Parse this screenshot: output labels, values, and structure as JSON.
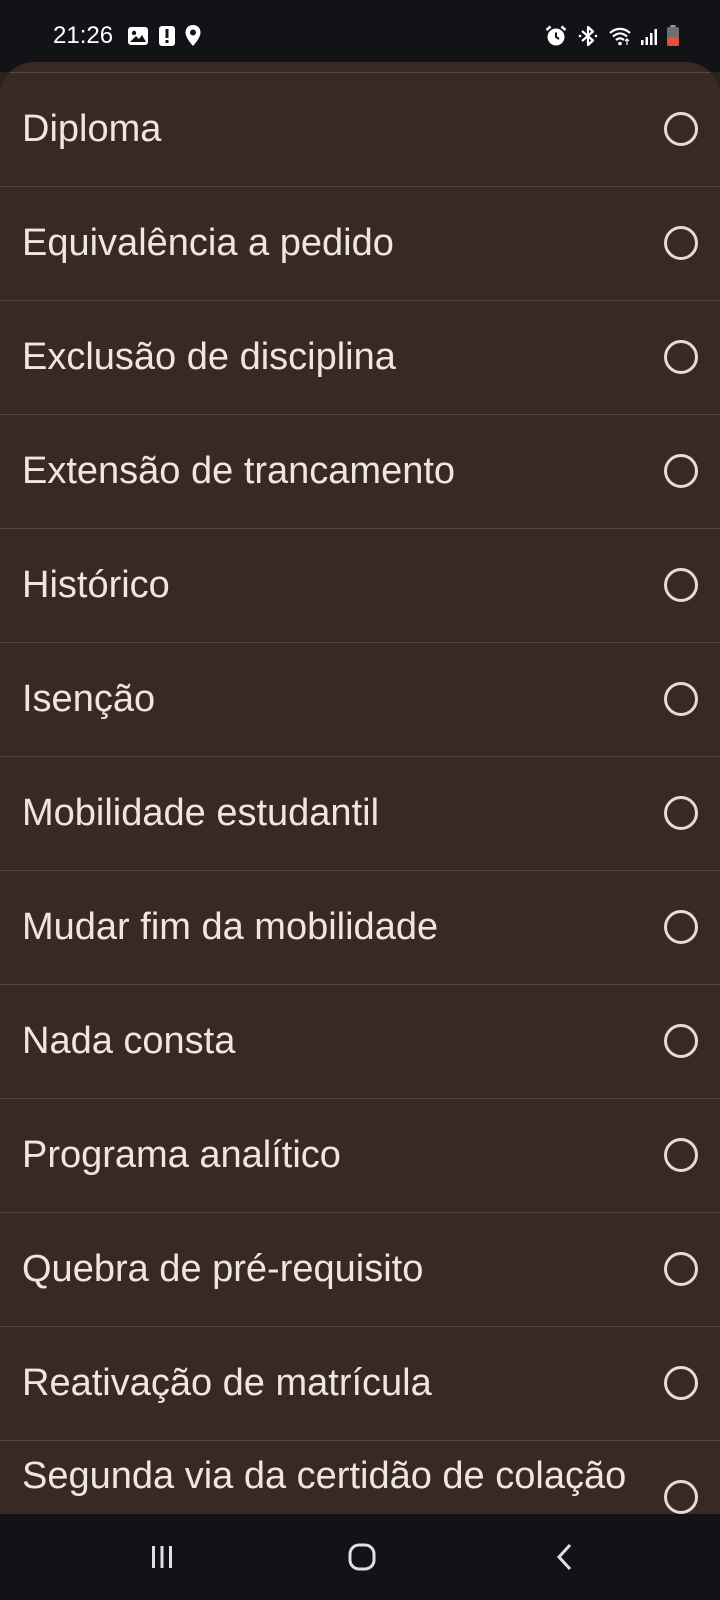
{
  "status_bar": {
    "time": "21:26",
    "left_icons": [
      "gallery-icon",
      "alert-icon",
      "location-icon"
    ],
    "right_icons": [
      "alarm-icon",
      "bluetooth-icon",
      "wifi-icon",
      "signal-icon",
      "battery-icon"
    ],
    "battery_color": "#e0523b"
  },
  "options": [
    {
      "label": "Diploma",
      "selected": false
    },
    {
      "label": "Equivalência a pedido",
      "selected": false
    },
    {
      "label": "Exclusão de disciplina",
      "selected": false
    },
    {
      "label": "Extensão de trancamento",
      "selected": false
    },
    {
      "label": "Histórico",
      "selected": false
    },
    {
      "label": "Isenção",
      "selected": false
    },
    {
      "label": "Mobilidade estudantil",
      "selected": false
    },
    {
      "label": "Mudar fim da mobilidade",
      "selected": false
    },
    {
      "label": "Nada consta",
      "selected": false
    },
    {
      "label": "Programa analítico",
      "selected": false
    },
    {
      "label": "Quebra de pré-requisito",
      "selected": false
    },
    {
      "label": "Reativação de matrícula",
      "selected": false
    },
    {
      "label": "Segunda via da certidão de colação",
      "selected": false
    }
  ],
  "nav_bar": {
    "buttons": [
      "recents-icon",
      "home-icon",
      "back-icon"
    ]
  },
  "colors": {
    "sheet_background": "#382a22",
    "text": "#efe6df",
    "divider": "#54463d",
    "radio_outline": "#e6dcd5",
    "system_bar": "#121316"
  }
}
